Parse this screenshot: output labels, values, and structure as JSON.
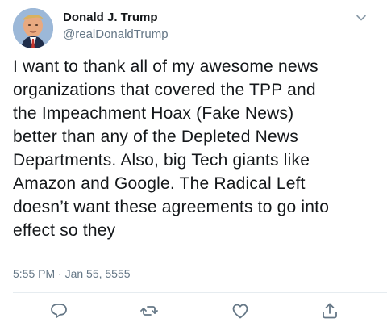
{
  "author": {
    "display_name": "Donald J. Trump",
    "handle": "@realDonaldTrump",
    "avatar_icon": "profile-photo"
  },
  "tweet": {
    "lines": [
      "I want to thank all of my awesome news",
      "organizations that covered the TPP and",
      "the Impeachment Hoax (Fake News)",
      "better than any of the Depleted News",
      "Departments. Also, big Tech giants like",
      "Amazon and Google. The Radical Left",
      "doesn’t want these agreements to go into",
      "effect so they"
    ],
    "timestamp": "5:55 PM · Jan 55, 5555"
  },
  "actions": {
    "reply_icon": "reply-icon",
    "retweet_icon": "retweet-icon",
    "like_icon": "like-icon",
    "share_icon": "share-icon",
    "menu_icon": "chevron-down-icon"
  },
  "colors": {
    "text_primary": "#14171a",
    "text_secondary": "#657786",
    "divider": "#e6ecf0"
  }
}
